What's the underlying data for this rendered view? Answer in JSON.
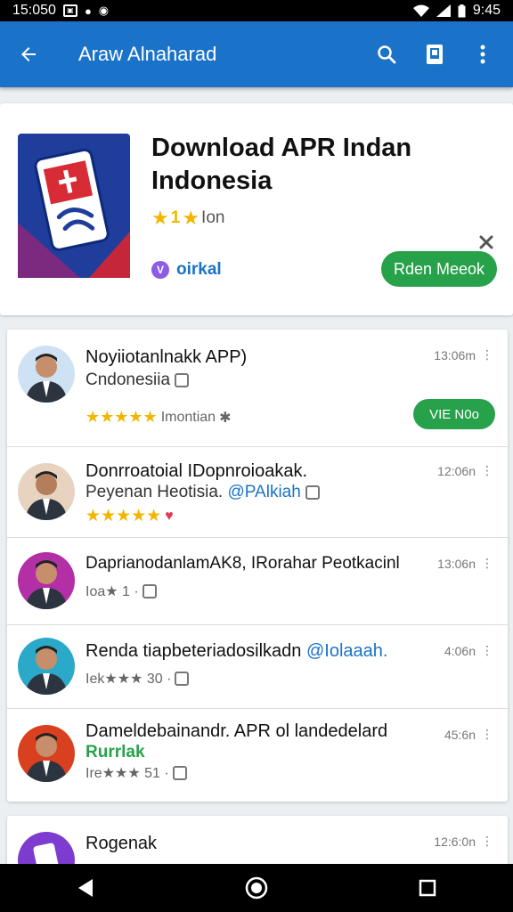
{
  "status": {
    "time_left": "15:050",
    "time_right": "9:45"
  },
  "appbar": {
    "title": "Araw Alnaharad"
  },
  "hero": {
    "title_line1": "Download APR Indan",
    "title_line2": "Indonesia",
    "rating_num": "1",
    "rating_text": "Ion",
    "developer": "oirkal",
    "developer_badge": "V",
    "button_label": "Rden Meeok"
  },
  "list": [
    {
      "title": "Noyiiotanlnakk APP)",
      "subtitle": "Cndonesiia",
      "meta_text": "Imontian",
      "time": "13:06m",
      "button_label": "VIE N0o",
      "avatar_bg": "#cfe2f3"
    },
    {
      "title": "Donrroatoial IDopnroioakak.",
      "subtitle": "Peyenan Heotisia.",
      "subtitle_accent": "@PAlkiah",
      "time": "12:06n",
      "avatar_bg": "#e8d3c0"
    },
    {
      "title": "DaprianodanlamAK8, IRorahar Peotkacinl",
      "meta_text": "Ioa★ 1 ·",
      "time": "13:06n",
      "avatar_bg": "#b22fa6"
    },
    {
      "title": "Renda tiapbeteriadosilkadn",
      "title_accent": "@Iolaaah.",
      "meta_text": "Iek★★★ 30 ·",
      "time": "4:06n",
      "avatar_bg": "#2aa9c9"
    },
    {
      "title": "Dameldebainandr. APR ol landedelard",
      "subtitle": "Rurrlak",
      "meta_text": "Ire★★★ 51 ·",
      "time": "45:6n",
      "avatar_bg": "#d8401f"
    }
  ],
  "last_item": {
    "title": "Rogenak",
    "time": "12:6:0n",
    "avatar_bg": "#7e3bcf"
  },
  "colors": {
    "accent": "#1a73c8",
    "install_green": "#27a24a",
    "star": "#f2b600"
  }
}
